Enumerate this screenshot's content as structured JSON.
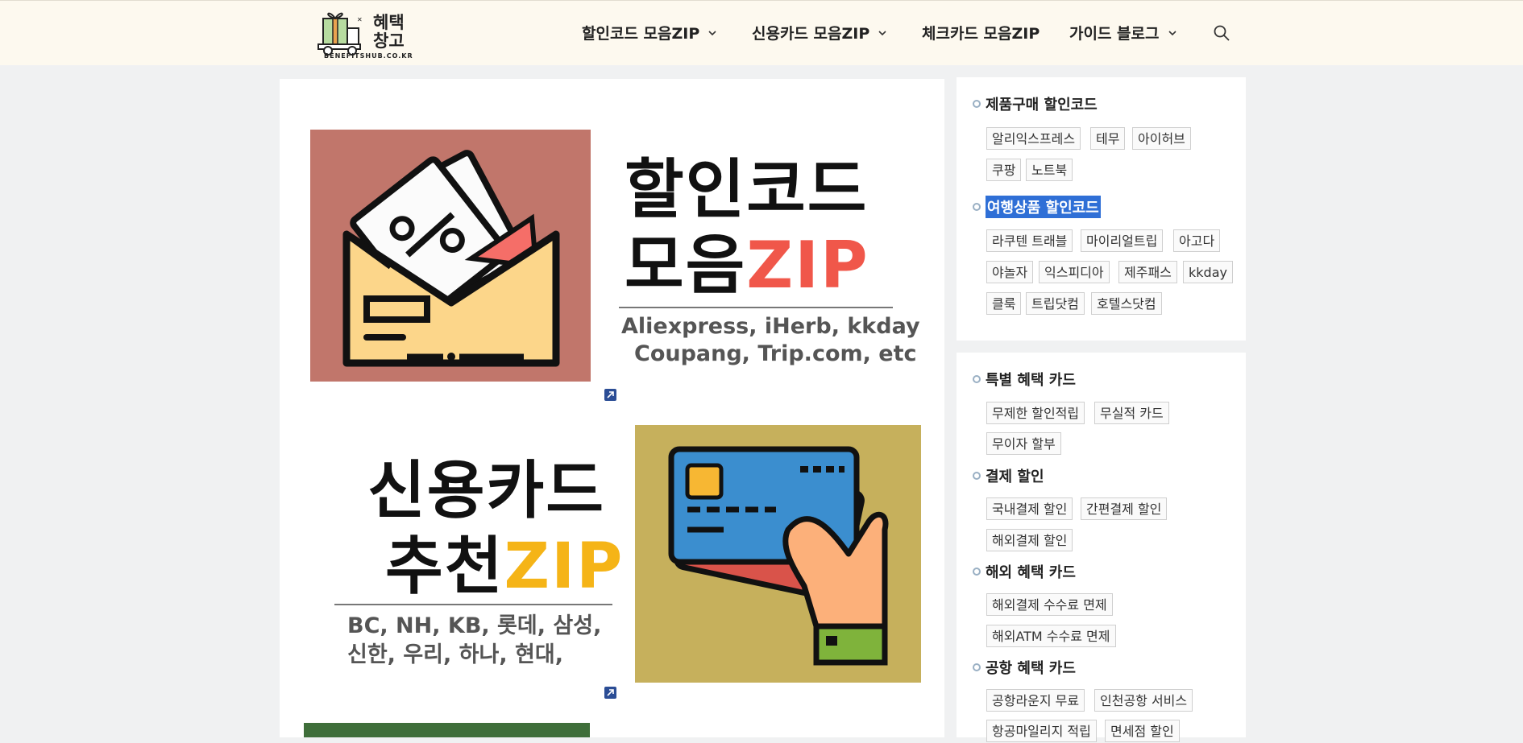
{
  "header": {
    "logo_text_line1": "혜택",
    "logo_text_line2": "창고",
    "logo_sub": "BENEFITSHUB.CO.KR",
    "nav": [
      {
        "label": "할인코드 모음ZIP",
        "has_dropdown": true
      },
      {
        "label": "신용카드 모음ZIP",
        "has_dropdown": true
      },
      {
        "label": "체크카드 모음ZIP",
        "has_dropdown": false
      },
      {
        "label": "가이드 블로그",
        "has_dropdown": true
      }
    ],
    "search_icon": "search-icon"
  },
  "banners": [
    {
      "title_line1": "할인코드",
      "title_line2_prefix": "모음",
      "title_line2_accent": "ZIP",
      "accent_color": "#f0574a",
      "subtitle_line1": "Aliexpress, iHerb, kkday",
      "subtitle_line2": "Coupang, Trip.com, etc",
      "image": "discount-coupon-envelope"
    },
    {
      "title_line1": "신용카드",
      "title_line2_prefix": "추천",
      "title_line2_accent": "ZIP",
      "accent_color": "#f5b417",
      "subtitle_line1": "BC, NH, KB, 롯데, 삼성,",
      "subtitle_line2": "신한, 우리, 하나, 현대,",
      "image": "credit-card-hand"
    }
  ],
  "sidebar": {
    "widget1": {
      "groups": [
        {
          "title": "제품구매 할인코드",
          "selected": false,
          "tags": [
            "알리익스프레스",
            "테무",
            "아이허브",
            "쿠팡",
            "노트북"
          ]
        },
        {
          "title": "여행상품 할인코드",
          "selected": true,
          "tags": [
            "라쿠텐 트래블",
            "마이리얼트립",
            "아고다",
            "야놀자",
            "익스피디아",
            "제주패스",
            "kkday",
            "클룩",
            "트립닷컴",
            "호텔스닷컴"
          ]
        }
      ]
    },
    "widget2": {
      "groups": [
        {
          "title": "특별 혜택 카드",
          "tags": [
            "무제한 할인적립",
            "무실적 카드",
            "무이자 할부"
          ]
        },
        {
          "title": "결제 할인",
          "tags": [
            "국내결제 할인",
            "간편결제 할인",
            "해외결제 할인"
          ]
        },
        {
          "title": "해외 혜택 카드",
          "tags": [
            "해외결제 수수료 면제",
            "해외ATM 수수료 면제"
          ]
        },
        {
          "title": "공항 혜택 카드",
          "tags": [
            "공항라운지 무료",
            "인천공항 서비스",
            "항공마일리지 적립",
            "면세점 할인"
          ]
        }
      ]
    }
  },
  "colors": {
    "header_bg": "#fdf9ef",
    "page_bg": "#f0f1f2",
    "selection": "#2f6fd6"
  }
}
